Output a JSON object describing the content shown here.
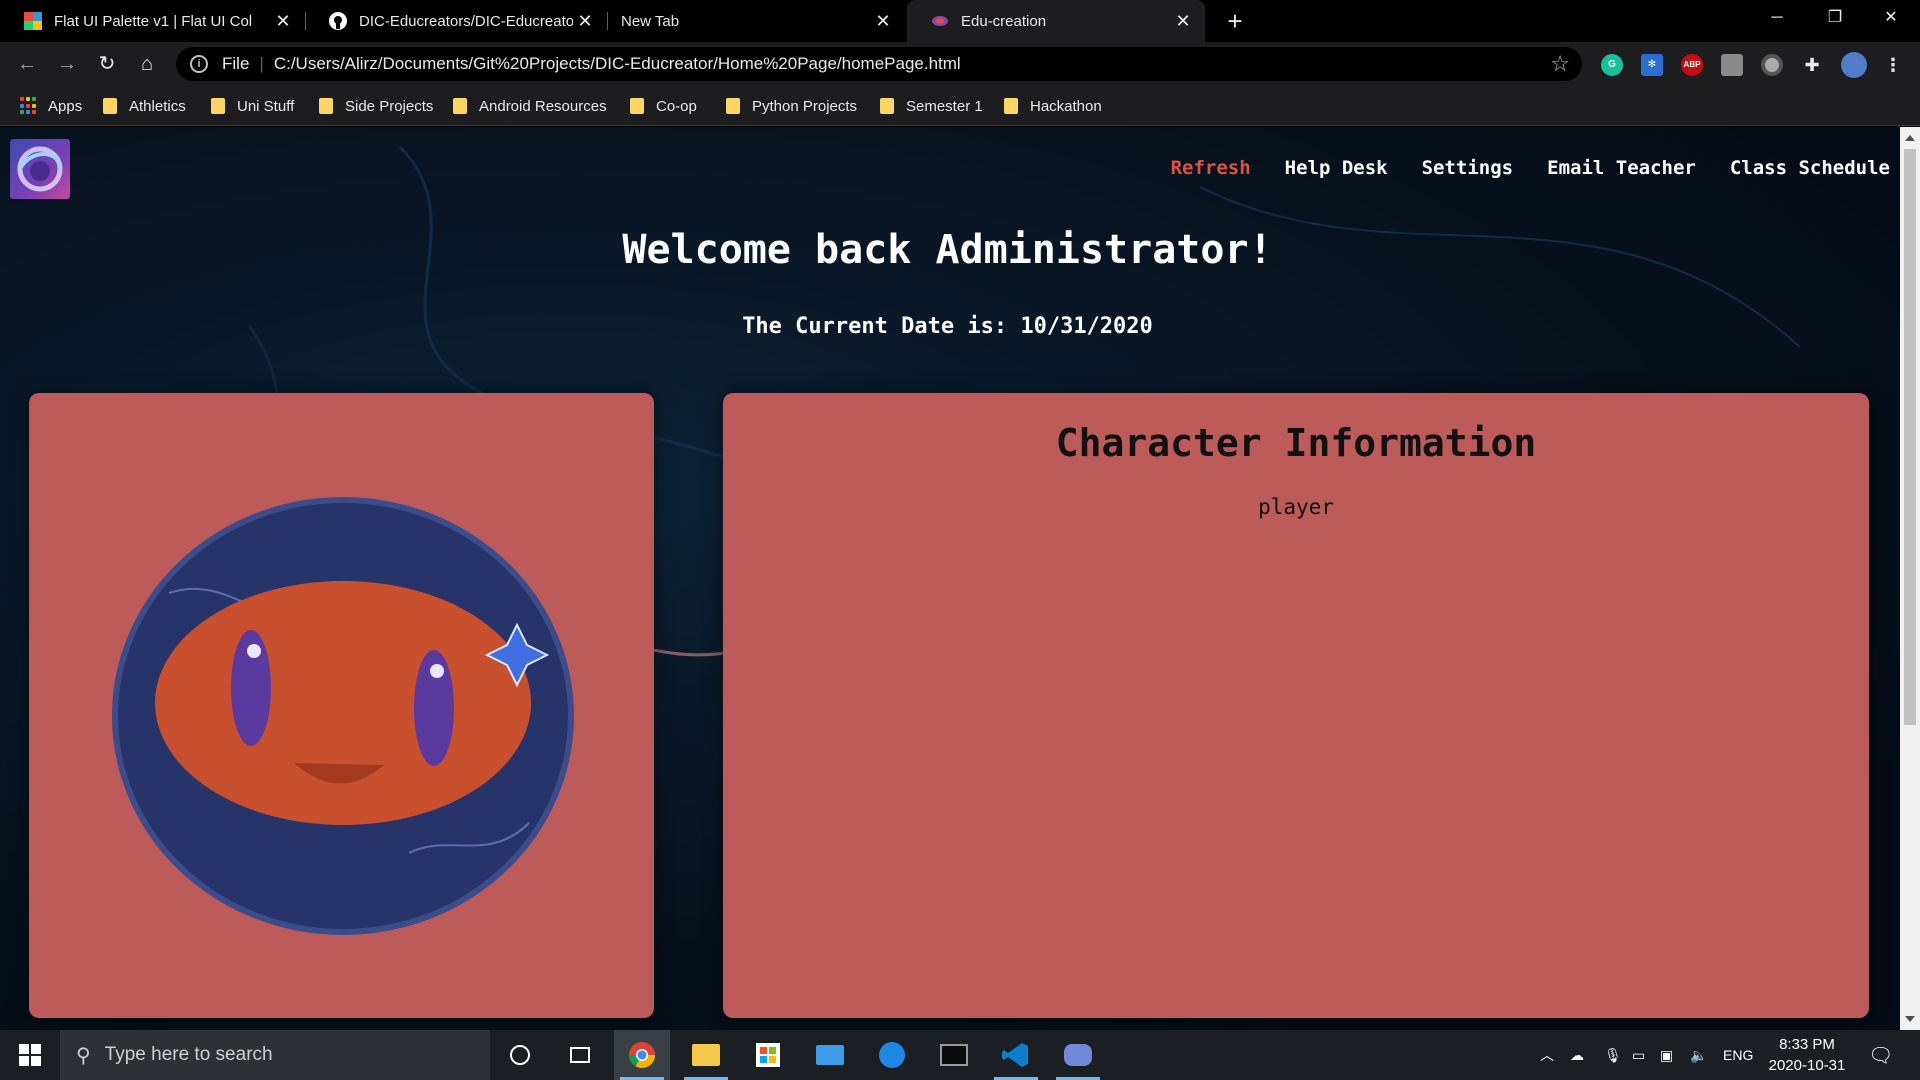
{
  "browser": {
    "tabs": [
      {
        "title": "Flat UI Palette v1 | Flat UI Col",
        "icon": "flat-ui-favicon"
      },
      {
        "title": "DIC-Educreators/DIC-Educreator",
        "icon": "github-icon"
      },
      {
        "title": "New Tab",
        "icon": ""
      },
      {
        "title": "Edu-creation",
        "icon": "edu-creation-favicon"
      }
    ],
    "omnibox": {
      "scheme": "File",
      "url": "C:/Users/Alirz/Documents/Git%20Projects/DIC-Educreator/Home%20Page/homePage.html"
    },
    "extensions": [
      "G",
      "ABP"
    ],
    "bookmarks": [
      "Apps",
      "Athletics",
      "Uni Stuff",
      "Side Projects",
      "Android Resources",
      "Co-op",
      "Python Projects",
      "Semester 1",
      "Hackathon"
    ]
  },
  "page": {
    "nav": [
      "Refresh",
      "Help Desk",
      "Settings",
      "Email Teacher",
      "Class Schedule"
    ],
    "welcome": "Welcome back Administrator!",
    "date_line": "The Current Date is: 10/31/2020",
    "character": {
      "title": "Character Information",
      "subtitle": "player"
    },
    "colors": {
      "card": "#bd5a5a",
      "nav_active": "#e2513f",
      "background": "#081524"
    }
  },
  "taskbar": {
    "search_placeholder": "Type here to search",
    "language": "ENG",
    "time": "8:33 PM",
    "date": "2020-10-31"
  }
}
